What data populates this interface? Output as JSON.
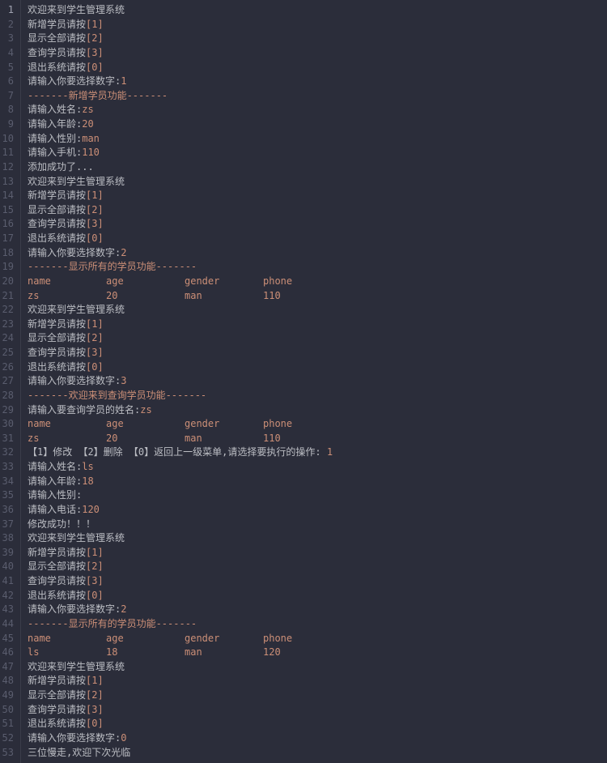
{
  "lines": [
    {
      "n": 1,
      "segs": [
        {
          "t": "欢迎来到学生管理系统",
          "c": "txt"
        }
      ]
    },
    {
      "n": 2,
      "segs": [
        {
          "t": "新增学员请按",
          "c": "txt"
        },
        {
          "t": "[1]",
          "c": "key"
        }
      ]
    },
    {
      "n": 3,
      "segs": [
        {
          "t": "显示全部请按",
          "c": "txt"
        },
        {
          "t": "[2]",
          "c": "key"
        }
      ]
    },
    {
      "n": 4,
      "segs": [
        {
          "t": "查询学员请按",
          "c": "txt"
        },
        {
          "t": "[3]",
          "c": "key"
        }
      ]
    },
    {
      "n": 5,
      "segs": [
        {
          "t": "退出系统请按",
          "c": "txt"
        },
        {
          "t": "[0]",
          "c": "key"
        }
      ]
    },
    {
      "n": 6,
      "segs": [
        {
          "t": "请输入你要选择数字:",
          "c": "txt"
        },
        {
          "t": "1",
          "c": "val"
        }
      ]
    },
    {
      "n": 7,
      "segs": [
        {
          "t": "-------新增学员功能-------",
          "c": "sep"
        }
      ]
    },
    {
      "n": 8,
      "segs": [
        {
          "t": "请输入姓名:",
          "c": "txt"
        },
        {
          "t": "zs",
          "c": "val"
        }
      ]
    },
    {
      "n": 9,
      "segs": [
        {
          "t": "请输入年龄:",
          "c": "txt"
        },
        {
          "t": "20",
          "c": "val"
        }
      ]
    },
    {
      "n": 10,
      "segs": [
        {
          "t": "请输入性别:",
          "c": "txt"
        },
        {
          "t": "man",
          "c": "val"
        }
      ]
    },
    {
      "n": 11,
      "segs": [
        {
          "t": "请输入手机:",
          "c": "txt"
        },
        {
          "t": "110",
          "c": "val"
        }
      ]
    },
    {
      "n": 12,
      "segs": [
        {
          "t": "添加成功了...",
          "c": "txt"
        }
      ]
    },
    {
      "n": 13,
      "segs": [
        {
          "t": "欢迎来到学生管理系统",
          "c": "txt"
        }
      ]
    },
    {
      "n": 14,
      "segs": [
        {
          "t": "新增学员请按",
          "c": "txt"
        },
        {
          "t": "[1]",
          "c": "key"
        }
      ]
    },
    {
      "n": 15,
      "segs": [
        {
          "t": "显示全部请按",
          "c": "txt"
        },
        {
          "t": "[2]",
          "c": "key"
        }
      ]
    },
    {
      "n": 16,
      "segs": [
        {
          "t": "查询学员请按",
          "c": "txt"
        },
        {
          "t": "[3]",
          "c": "key"
        }
      ]
    },
    {
      "n": 17,
      "segs": [
        {
          "t": "退出系统请按",
          "c": "txt"
        },
        {
          "t": "[0]",
          "c": "key"
        }
      ]
    },
    {
      "n": 18,
      "segs": [
        {
          "t": "请输入你要选择数字:",
          "c": "txt"
        },
        {
          "t": "2",
          "c": "val"
        }
      ]
    },
    {
      "n": 19,
      "segs": [
        {
          "t": "-------显示所有的学员功能-------",
          "c": "sep"
        }
      ]
    },
    {
      "n": 20,
      "cols": [
        {
          "t": "name",
          "c": "key"
        },
        {
          "t": "age",
          "c": "key"
        },
        {
          "t": "gender",
          "c": "key"
        },
        {
          "t": "phone",
          "c": "key"
        }
      ]
    },
    {
      "n": 21,
      "cols": [
        {
          "t": "zs",
          "c": "key"
        },
        {
          "t": "20",
          "c": "key"
        },
        {
          "t": "man",
          "c": "key"
        },
        {
          "t": "110",
          "c": "key"
        }
      ]
    },
    {
      "n": 22,
      "segs": [
        {
          "t": "欢迎来到学生管理系统",
          "c": "txt"
        }
      ]
    },
    {
      "n": 23,
      "segs": [
        {
          "t": "新增学员请按",
          "c": "txt"
        },
        {
          "t": "[1]",
          "c": "key"
        }
      ]
    },
    {
      "n": 24,
      "segs": [
        {
          "t": "显示全部请按",
          "c": "txt"
        },
        {
          "t": "[2]",
          "c": "key"
        }
      ]
    },
    {
      "n": 25,
      "segs": [
        {
          "t": "查询学员请按",
          "c": "txt"
        },
        {
          "t": "[3]",
          "c": "key"
        }
      ]
    },
    {
      "n": 26,
      "segs": [
        {
          "t": "退出系统请按",
          "c": "txt"
        },
        {
          "t": "[0]",
          "c": "key"
        }
      ]
    },
    {
      "n": 27,
      "segs": [
        {
          "t": "请输入你要选择数字:",
          "c": "txt"
        },
        {
          "t": "3",
          "c": "val"
        }
      ]
    },
    {
      "n": 28,
      "segs": [
        {
          "t": "-------欢迎来到查询学员功能-------",
          "c": "sep"
        }
      ]
    },
    {
      "n": 29,
      "segs": [
        {
          "t": "请输入要查询学员的姓名:",
          "c": "txt"
        },
        {
          "t": "zs",
          "c": "val"
        }
      ]
    },
    {
      "n": 30,
      "cols": [
        {
          "t": "name",
          "c": "key"
        },
        {
          "t": "age",
          "c": "key"
        },
        {
          "t": "gender",
          "c": "key"
        },
        {
          "t": "phone",
          "c": "key"
        }
      ]
    },
    {
      "n": 31,
      "cols": [
        {
          "t": "zs",
          "c": "key"
        },
        {
          "t": "20",
          "c": "key"
        },
        {
          "t": "man",
          "c": "key"
        },
        {
          "t": "110",
          "c": "key"
        }
      ]
    },
    {
      "n": 32,
      "segs": [
        {
          "t": "【1】修改 【2】删除 【0】返回上一级菜单,请选择要执行的操作: ",
          "c": "txt"
        },
        {
          "t": "1",
          "c": "val"
        }
      ]
    },
    {
      "n": 33,
      "segs": [
        {
          "t": "请输入姓名:",
          "c": "txt"
        },
        {
          "t": "ls",
          "c": "val"
        }
      ]
    },
    {
      "n": 34,
      "segs": [
        {
          "t": "请输入年龄:",
          "c": "txt"
        },
        {
          "t": "18",
          "c": "val"
        }
      ]
    },
    {
      "n": 35,
      "segs": [
        {
          "t": "请输入性别:",
          "c": "txt"
        }
      ]
    },
    {
      "n": 36,
      "segs": [
        {
          "t": "请输入电话:",
          "c": "txt"
        },
        {
          "t": "120",
          "c": "val"
        }
      ]
    },
    {
      "n": 37,
      "segs": [
        {
          "t": "修改成功！！！",
          "c": "txt"
        }
      ]
    },
    {
      "n": 38,
      "segs": [
        {
          "t": "欢迎来到学生管理系统",
          "c": "txt"
        }
      ]
    },
    {
      "n": 39,
      "segs": [
        {
          "t": "新增学员请按",
          "c": "txt"
        },
        {
          "t": "[1]",
          "c": "key"
        }
      ]
    },
    {
      "n": 40,
      "segs": [
        {
          "t": "显示全部请按",
          "c": "txt"
        },
        {
          "t": "[2]",
          "c": "key"
        }
      ]
    },
    {
      "n": 41,
      "segs": [
        {
          "t": "查询学员请按",
          "c": "txt"
        },
        {
          "t": "[3]",
          "c": "key"
        }
      ]
    },
    {
      "n": 42,
      "segs": [
        {
          "t": "退出系统请按",
          "c": "txt"
        },
        {
          "t": "[0]",
          "c": "key"
        }
      ]
    },
    {
      "n": 43,
      "segs": [
        {
          "t": "请输入你要选择数字:",
          "c": "txt"
        },
        {
          "t": "2",
          "c": "val"
        }
      ]
    },
    {
      "n": 44,
      "segs": [
        {
          "t": "-------显示所有的学员功能-------",
          "c": "sep"
        }
      ]
    },
    {
      "n": 45,
      "cols": [
        {
          "t": "name",
          "c": "key"
        },
        {
          "t": "age",
          "c": "key"
        },
        {
          "t": "gender",
          "c": "key"
        },
        {
          "t": "phone",
          "c": "key"
        }
      ]
    },
    {
      "n": 46,
      "cols": [
        {
          "t": "ls",
          "c": "key"
        },
        {
          "t": "18",
          "c": "key"
        },
        {
          "t": "man",
          "c": "key"
        },
        {
          "t": "120",
          "c": "key"
        }
      ]
    },
    {
      "n": 47,
      "segs": [
        {
          "t": "欢迎来到学生管理系统",
          "c": "txt"
        }
      ]
    },
    {
      "n": 48,
      "segs": [
        {
          "t": "新增学员请按",
          "c": "txt"
        },
        {
          "t": "[1]",
          "c": "key"
        }
      ]
    },
    {
      "n": 49,
      "segs": [
        {
          "t": "显示全部请按",
          "c": "txt"
        },
        {
          "t": "[2]",
          "c": "key"
        }
      ]
    },
    {
      "n": 50,
      "segs": [
        {
          "t": "查询学员请按",
          "c": "txt"
        },
        {
          "t": "[3]",
          "c": "key"
        }
      ]
    },
    {
      "n": 51,
      "segs": [
        {
          "t": "退出系统请按",
          "c": "txt"
        },
        {
          "t": "[0]",
          "c": "key"
        }
      ]
    },
    {
      "n": 52,
      "segs": [
        {
          "t": "请输入你要选择数字:",
          "c": "txt"
        },
        {
          "t": "0",
          "c": "val"
        }
      ]
    },
    {
      "n": 53,
      "segs": [
        {
          "t": "三位慢走,欢迎下次光临",
          "c": "txt"
        }
      ]
    }
  ],
  "colClasses": [
    "col-name",
    "col-age",
    "col-gender",
    "col-phone"
  ]
}
